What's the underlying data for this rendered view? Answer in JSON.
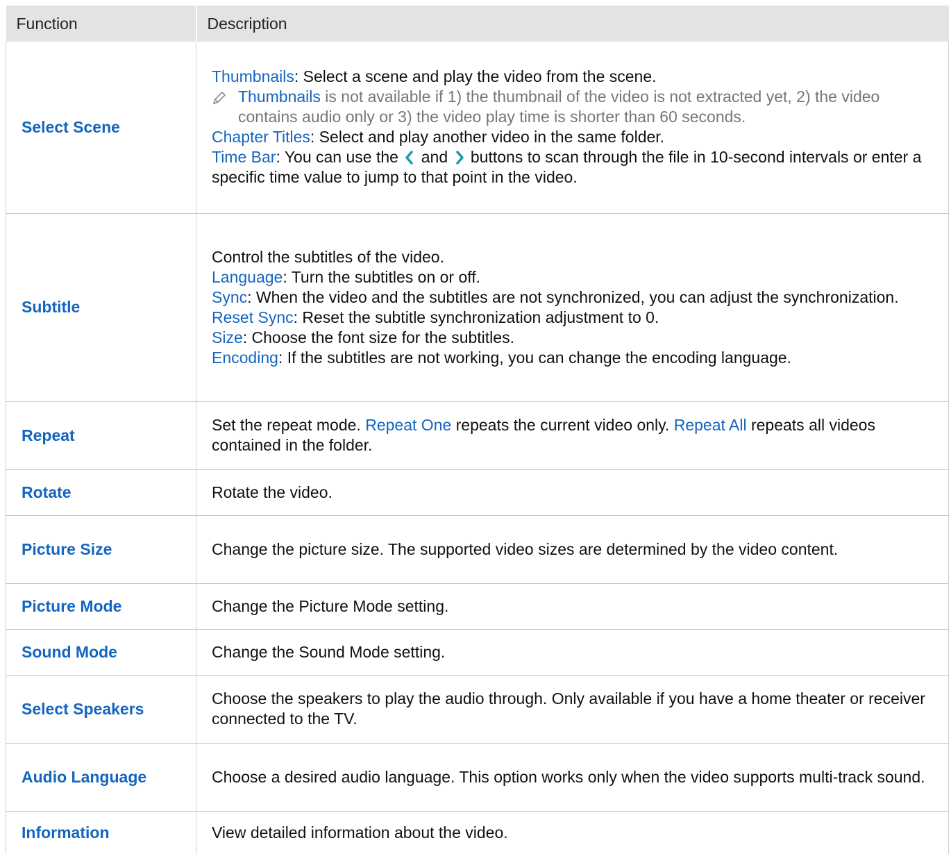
{
  "header": {
    "function": "Function",
    "description": "Description"
  },
  "rows": [
    {
      "function": "Select Scene",
      "lines": [
        {
          "term": "Thumbnails",
          "text": ": Select a scene and play the video from the scene."
        },
        {
          "note_term": "Thumbnails",
          "note_text": " is not available if 1) the thumbnail of the video is not extracted yet, 2) the video contains audio only or 3) the video play time is shorter than 60 seconds."
        },
        {
          "term": "Chapter Titles",
          "text": ": Select and play another video in the same folder."
        },
        {
          "term": "Time Bar",
          "text_a": ": You can use the ",
          "text_b": " and ",
          "text_c": " buttons to scan through the file in 10-second intervals or enter a specific time value to jump to that point in the video."
        }
      ]
    },
    {
      "function": "Subtitle",
      "intro": "Control the subtitles of the video.",
      "lines": [
        {
          "term": "Language",
          "text": ": Turn the subtitles on or off."
        },
        {
          "term": "Sync",
          "text": ": When the video and the subtitles are not synchronized, you can adjust the synchronization."
        },
        {
          "term": "Reset Sync",
          "text": ": Reset the subtitle synchronization adjustment to 0."
        },
        {
          "term": "Size",
          "text": ": Choose the font size for the subtitles."
        },
        {
          "term": "Encoding",
          "text": ": If the subtitles are not working, you can change the encoding language."
        }
      ]
    },
    {
      "function": "Repeat",
      "a": "Set the repeat mode. ",
      "t1": "Repeat One",
      "b": " repeats the current video only. ",
      "t2": "Repeat All",
      "c": " repeats all videos contained in the folder."
    },
    {
      "function": "Rotate",
      "description": "Rotate the video."
    },
    {
      "function": "Picture Size",
      "description": "Change the picture size. The supported video sizes are determined by the video content."
    },
    {
      "function": "Picture Mode",
      "description": "Change the Picture Mode setting."
    },
    {
      "function": "Sound Mode",
      "description": "Change the Sound Mode setting."
    },
    {
      "function": "Select Speakers",
      "description": "Choose the speakers to play the audio through. Only available if you have a home theater or receiver connected to the TV."
    },
    {
      "function": "Audio Language",
      "description": "Choose a desired audio language. This option works only when the video supports multi-track sound."
    },
    {
      "function": "Information",
      "description": "View detailed information about the video."
    }
  ],
  "colors": {
    "accent": "#1465c0",
    "header_bg": "#e3e3e3",
    "note": "#777777",
    "arrow": "#1f9aa8"
  },
  "icons": {
    "note": "pencil-icon",
    "left": "chevron-left-icon",
    "right": "chevron-right-icon"
  }
}
